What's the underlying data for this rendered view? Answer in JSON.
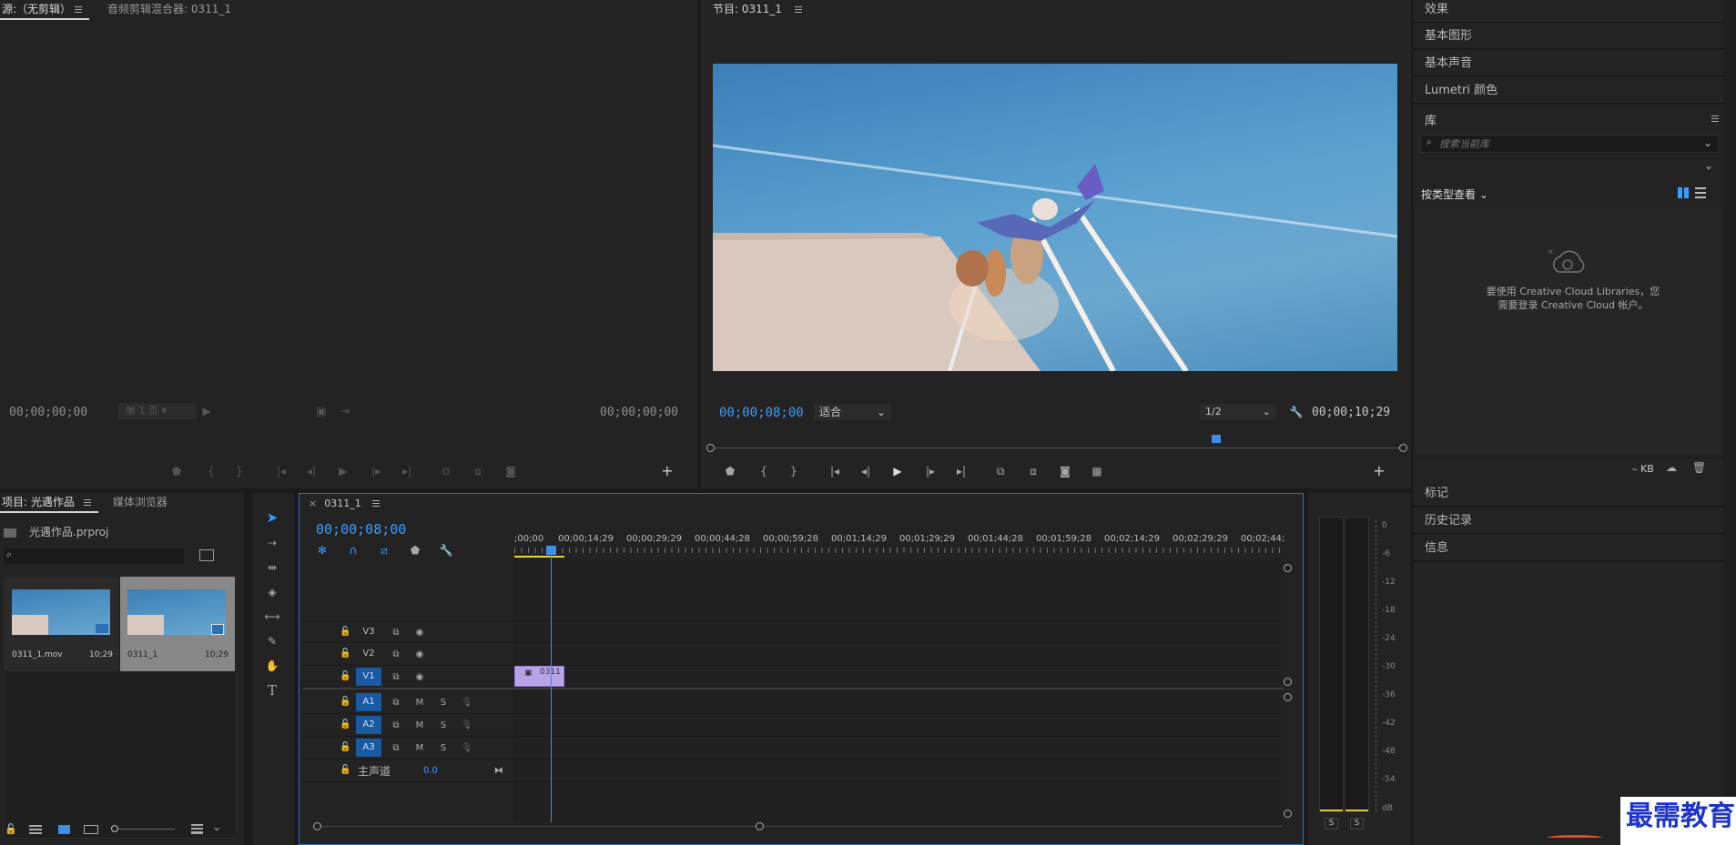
{
  "source_panel": {
    "tab_source": "源:（无剪辑）",
    "tab_mixer": "音频剪辑混合器: 0311_1",
    "timecode_left": "00;00;00;00",
    "timecode_right": "00;00;00;00",
    "page_select": "第 1 页"
  },
  "program_panel": {
    "tab": "节目: 0311_1",
    "timecode": "00;00;08;00",
    "fit": "适合",
    "resolution": "1/2",
    "duration": "00;00;10;29",
    "playhead_position_percent": 73
  },
  "right_panel": {
    "effects": "效果",
    "essential_graphics": "基本图形",
    "essential_sound": "基本声音",
    "lumetri": "Lumetri 颜色",
    "library": "库",
    "search_placeholder": "搜索当前库",
    "view_by_type": "按类型查看",
    "cc_message_line1": "要使用 Creative Cloud Libraries，您",
    "cc_message_line2": "需要登录 Creative Cloud 帐户。",
    "kb_label": "– KB",
    "markers": "标记",
    "history": "历史记录",
    "info": "信息"
  },
  "project_panel": {
    "tab_project": "项目: 光遇作品",
    "tab_media": "媒体浏览器",
    "project_file": "光遇作品.prproj",
    "items": [
      {
        "name": "0311_1.mov",
        "duration": "10;29"
      },
      {
        "name": "0311_1",
        "duration": "10;29"
      }
    ]
  },
  "timeline": {
    "tab": "0311_1",
    "timecode": "00;00;08;00",
    "ruler": [
      ";00;00",
      "00;00;14;29",
      "00;00;29;29",
      "00;00;44;28",
      "00;00;59;28",
      "00;01;14;29",
      "00;01;29;29",
      "00;01;44;28",
      "00;01;59;28",
      "00;02;14;29",
      "00;02;29;29",
      "00;02;44;"
    ],
    "video_tracks": [
      "V3",
      "V2",
      "V1"
    ],
    "audio_tracks": [
      "A1",
      "A2",
      "A3"
    ],
    "track_m": "M",
    "track_s": "S",
    "master_label": "主声道",
    "master_value": "0.0",
    "clip_label": "0311"
  },
  "audio_meter": {
    "scale": [
      "0",
      "-6",
      "-12",
      "-18",
      "-24",
      "-30",
      "-36",
      "-42",
      "-48",
      "-54",
      "dB"
    ],
    "solo_left": "S",
    "solo_right": "S"
  },
  "watermark": "最需教育"
}
